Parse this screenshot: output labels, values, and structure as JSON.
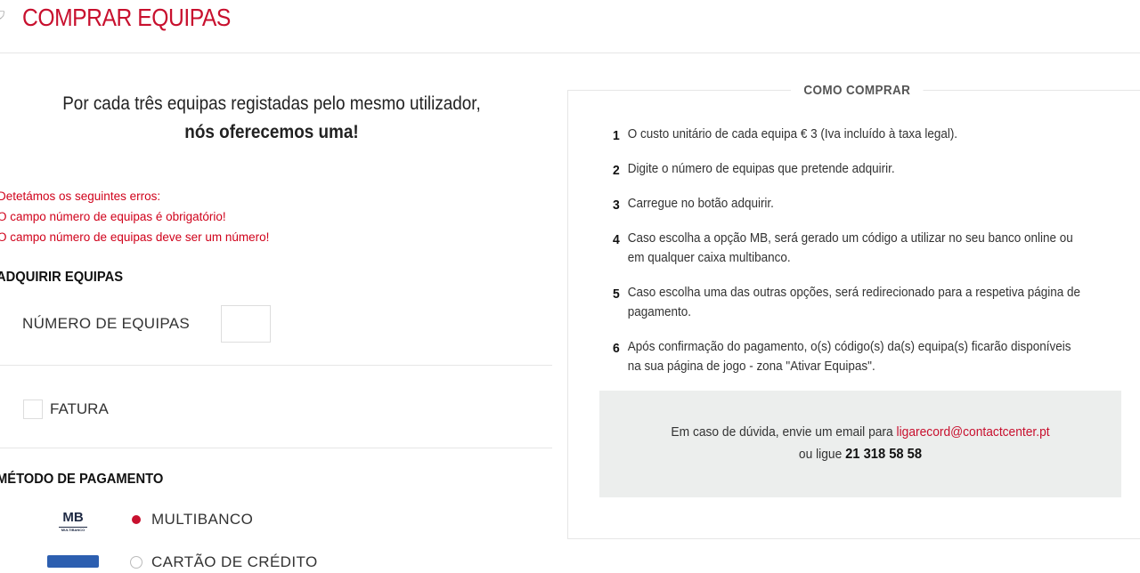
{
  "header": {
    "title": "COMPRAR EQUIPAS"
  },
  "promo": {
    "line1": "Por cada três equipas registadas pelo mesmo utilizador,",
    "line2": "nós oferecemos uma!"
  },
  "errors": [
    "Detetámos os seguintes erros:",
    "O campo número de equipas é obrigatório!",
    "O campo número de equipas deve ser um número!"
  ],
  "purchase": {
    "section_title": "ADQUIRIR EQUIPAS",
    "quantity_label": "NÚMERO DE EQUIPAS",
    "quantity_value": "",
    "invoice_label": "FATURA"
  },
  "payment": {
    "section_title": "MÉTODO DE PAGAMENTO",
    "mb_logo_text": "MB",
    "mb_logo_sub": "MULTIBANCO",
    "options": [
      {
        "label": "MULTIBANCO",
        "selected": true
      },
      {
        "label": "CARTÃO DE CRÉDITO",
        "selected": false
      }
    ]
  },
  "how_to_buy": {
    "title": "COMO COMPRAR",
    "steps": [
      {
        "num": "1",
        "text": "O custo unitário de cada equipa € 3 (Iva incluído à taxa legal)."
      },
      {
        "num": "2",
        "text": "Digite o número de equipas que pretende adquirir."
      },
      {
        "num": "3",
        "text": "Carregue no botão adquirir."
      },
      {
        "num": "4",
        "text": "Caso escolha a opção MB, será gerado um código a utilizar no seu banco online ou em qualquer caixa multibanco."
      },
      {
        "num": "5",
        "text": "Caso escolha uma das outras opções, será redirecionado para a respetiva página de pagamento."
      },
      {
        "num": "6",
        "text": "Após confirmação do pagamento, o(s) código(s) da(s) equipa(s) ficarão disponíveis na sua página de jogo - zona \"Ativar Equipas\"."
      }
    ],
    "contact": {
      "text_before": "Em caso de dúvida, envie um email para ",
      "email": "ligarecord@contactcenter.pt",
      "phone_prefix": "ou ligue ",
      "phone": "21 318 58 58"
    }
  },
  "colors": {
    "accent": "#c8102e",
    "error": "#d0021b",
    "contact_bg": "#eceeed"
  }
}
